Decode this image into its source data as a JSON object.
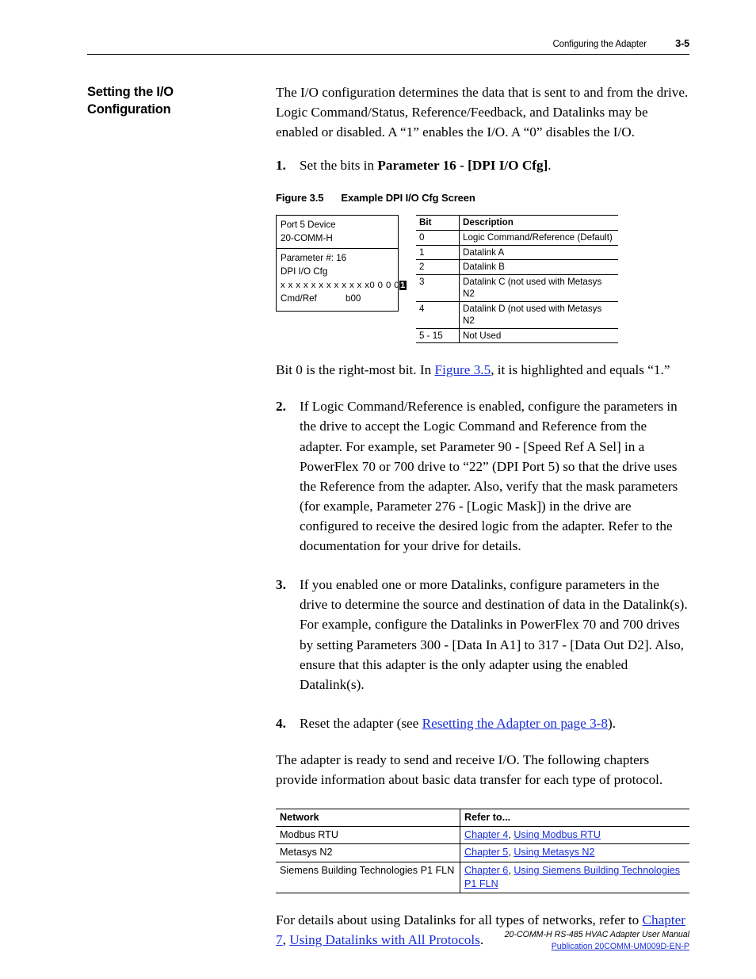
{
  "header": {
    "title": "Configuring the Adapter",
    "page_number": "3-5"
  },
  "section": {
    "heading_line1": "Setting the I/O",
    "heading_line2": "Configuration"
  },
  "intro": {
    "paragraph": "The I/O configuration determines the data that is sent to and from the drive. Logic Command/Status, Reference/Feedback, and Datalinks may be enabled or disabled. A “1” enables the I/O. A “0” disables the I/O."
  },
  "steps": [
    {
      "num": "1.",
      "pre": "Set the bits in ",
      "bold": "Parameter 16 - [DPI I/O Cfg]",
      "post": "."
    },
    {
      "num": "2.",
      "text": "If Logic Command/Reference is enabled, configure the parameters in the drive to accept the Logic Command and Reference from the adapter. For example, set Parameter 90 - [Speed Ref A Sel] in a PowerFlex 70 or 700 drive to “22” (DPI Port 5) so that the drive uses the Reference from the adapter. Also, verify that the mask parameters (for example, Parameter 276 - [Logic Mask]) in the drive are configured to receive the desired logic from the adapter. Refer to the documentation for your drive for details."
    },
    {
      "num": "3.",
      "text": "If you enabled one or more Datalinks, configure parameters in the drive to determine the source and destination of data in the Datalink(s). For example, configure the Datalinks in PowerFlex 70 and 700 drives by setting Parameters 300 - [Data In A1] to 317 - [Data Out D2]. Also, ensure that this adapter is the only adapter using the enabled Datalink(s)."
    },
    {
      "num": "4.",
      "pre": "Reset the adapter (see ",
      "link": "Resetting the Adapter on page 3-8",
      "post": ")."
    }
  ],
  "figure": {
    "label": "Figure 3.5",
    "title": "Example DPI I/O Cfg Screen",
    "screen": {
      "port_line": "Port 5 Device",
      "device_line": "20-COMM-H",
      "parameter_line": "Parameter #: 16",
      "name_line": "DPI I/O Cfg",
      "bits_x": "x x x x x x x x x x x x",
      "bits_zeros": "0 0 0 0",
      "bits_highlight": "1",
      "cmdref_label": "Cmd/Ref",
      "cmdref_value": "b00"
    },
    "bit_table": {
      "columns": [
        "Bit",
        "Description"
      ],
      "rows": [
        [
          "0",
          "Logic Command/Reference (Default)"
        ],
        [
          "1",
          "Datalink A"
        ],
        [
          "2",
          "Datalink B"
        ],
        [
          "3",
          "Datalink C (not used with Metasys N2"
        ],
        [
          "4",
          "Datalink D (not used with Metasys N2"
        ],
        [
          "5 - 15",
          "Not Used"
        ]
      ]
    }
  },
  "after_figure": {
    "pre": "Bit 0 is the right-most bit. In ",
    "link": "Figure 3.5",
    "post": ", it is highlighted and equals “1.”"
  },
  "ready_paragraph": "The adapter is ready to send and receive I/O. The following chapters provide information about basic data transfer for each type of protocol.",
  "network_table": {
    "columns": [
      "Network",
      "Refer to..."
    ],
    "rows": [
      {
        "network": "Modbus RTU",
        "chapter": "Chapter 4",
        "sep": ", ",
        "topic": "Using Modbus RTU"
      },
      {
        "network": "Metasys N2",
        "chapter": "Chapter 5",
        "sep": ", ",
        "topic": "Using Metasys N2"
      },
      {
        "network": "Siemens Building Technologies P1 FLN",
        "chapter": "Chapter 6",
        "sep": ", ",
        "topic": "Using Siemens Building Technologies P1 FLN"
      }
    ]
  },
  "closing": {
    "pre": "For details about using Datalinks for all types of networks, refer to ",
    "link1": "Chapter 7",
    "sep": ", ",
    "link2": "Using Datalinks with All Protocols",
    "post": "."
  },
  "footer": {
    "line1": "20-COMM-H RS-485 HVAC Adapter User Manual",
    "line2": "Publication 20COMM-UM009D-EN-P"
  }
}
